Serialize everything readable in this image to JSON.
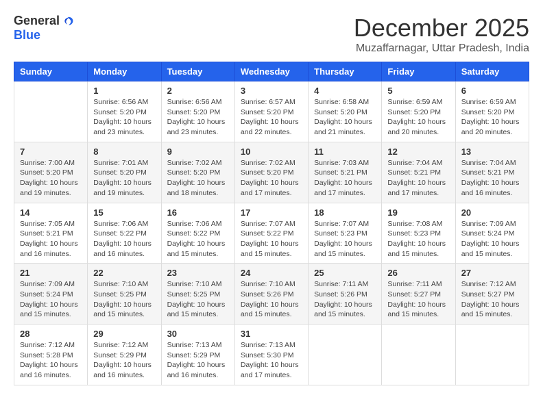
{
  "header": {
    "logo_general": "General",
    "logo_blue": "Blue",
    "month": "December 2025",
    "location": "Muzaffarnagar, Uttar Pradesh, India"
  },
  "days_of_week": [
    "Sunday",
    "Monday",
    "Tuesday",
    "Wednesday",
    "Thursday",
    "Friday",
    "Saturday"
  ],
  "weeks": [
    [
      {
        "day": "",
        "info": ""
      },
      {
        "day": "1",
        "info": "Sunrise: 6:56 AM\nSunset: 5:20 PM\nDaylight: 10 hours\nand 23 minutes."
      },
      {
        "day": "2",
        "info": "Sunrise: 6:56 AM\nSunset: 5:20 PM\nDaylight: 10 hours\nand 23 minutes."
      },
      {
        "day": "3",
        "info": "Sunrise: 6:57 AM\nSunset: 5:20 PM\nDaylight: 10 hours\nand 22 minutes."
      },
      {
        "day": "4",
        "info": "Sunrise: 6:58 AM\nSunset: 5:20 PM\nDaylight: 10 hours\nand 21 minutes."
      },
      {
        "day": "5",
        "info": "Sunrise: 6:59 AM\nSunset: 5:20 PM\nDaylight: 10 hours\nand 20 minutes."
      },
      {
        "day": "6",
        "info": "Sunrise: 6:59 AM\nSunset: 5:20 PM\nDaylight: 10 hours\nand 20 minutes."
      }
    ],
    [
      {
        "day": "7",
        "info": "Sunrise: 7:00 AM\nSunset: 5:20 PM\nDaylight: 10 hours\nand 19 minutes."
      },
      {
        "day": "8",
        "info": "Sunrise: 7:01 AM\nSunset: 5:20 PM\nDaylight: 10 hours\nand 19 minutes."
      },
      {
        "day": "9",
        "info": "Sunrise: 7:02 AM\nSunset: 5:20 PM\nDaylight: 10 hours\nand 18 minutes."
      },
      {
        "day": "10",
        "info": "Sunrise: 7:02 AM\nSunset: 5:20 PM\nDaylight: 10 hours\nand 17 minutes."
      },
      {
        "day": "11",
        "info": "Sunrise: 7:03 AM\nSunset: 5:21 PM\nDaylight: 10 hours\nand 17 minutes."
      },
      {
        "day": "12",
        "info": "Sunrise: 7:04 AM\nSunset: 5:21 PM\nDaylight: 10 hours\nand 17 minutes."
      },
      {
        "day": "13",
        "info": "Sunrise: 7:04 AM\nSunset: 5:21 PM\nDaylight: 10 hours\nand 16 minutes."
      }
    ],
    [
      {
        "day": "14",
        "info": "Sunrise: 7:05 AM\nSunset: 5:21 PM\nDaylight: 10 hours\nand 16 minutes."
      },
      {
        "day": "15",
        "info": "Sunrise: 7:06 AM\nSunset: 5:22 PM\nDaylight: 10 hours\nand 16 minutes."
      },
      {
        "day": "16",
        "info": "Sunrise: 7:06 AM\nSunset: 5:22 PM\nDaylight: 10 hours\nand 15 minutes."
      },
      {
        "day": "17",
        "info": "Sunrise: 7:07 AM\nSunset: 5:22 PM\nDaylight: 10 hours\nand 15 minutes."
      },
      {
        "day": "18",
        "info": "Sunrise: 7:07 AM\nSunset: 5:23 PM\nDaylight: 10 hours\nand 15 minutes."
      },
      {
        "day": "19",
        "info": "Sunrise: 7:08 AM\nSunset: 5:23 PM\nDaylight: 10 hours\nand 15 minutes."
      },
      {
        "day": "20",
        "info": "Sunrise: 7:09 AM\nSunset: 5:24 PM\nDaylight: 10 hours\nand 15 minutes."
      }
    ],
    [
      {
        "day": "21",
        "info": "Sunrise: 7:09 AM\nSunset: 5:24 PM\nDaylight: 10 hours\nand 15 minutes."
      },
      {
        "day": "22",
        "info": "Sunrise: 7:10 AM\nSunset: 5:25 PM\nDaylight: 10 hours\nand 15 minutes."
      },
      {
        "day": "23",
        "info": "Sunrise: 7:10 AM\nSunset: 5:25 PM\nDaylight: 10 hours\nand 15 minutes."
      },
      {
        "day": "24",
        "info": "Sunrise: 7:10 AM\nSunset: 5:26 PM\nDaylight: 10 hours\nand 15 minutes."
      },
      {
        "day": "25",
        "info": "Sunrise: 7:11 AM\nSunset: 5:26 PM\nDaylight: 10 hours\nand 15 minutes."
      },
      {
        "day": "26",
        "info": "Sunrise: 7:11 AM\nSunset: 5:27 PM\nDaylight: 10 hours\nand 15 minutes."
      },
      {
        "day": "27",
        "info": "Sunrise: 7:12 AM\nSunset: 5:27 PM\nDaylight: 10 hours\nand 15 minutes."
      }
    ],
    [
      {
        "day": "28",
        "info": "Sunrise: 7:12 AM\nSunset: 5:28 PM\nDaylight: 10 hours\nand 16 minutes."
      },
      {
        "day": "29",
        "info": "Sunrise: 7:12 AM\nSunset: 5:29 PM\nDaylight: 10 hours\nand 16 minutes."
      },
      {
        "day": "30",
        "info": "Sunrise: 7:13 AM\nSunset: 5:29 PM\nDaylight: 10 hours\nand 16 minutes."
      },
      {
        "day": "31",
        "info": "Sunrise: 7:13 AM\nSunset: 5:30 PM\nDaylight: 10 hours\nand 17 minutes."
      },
      {
        "day": "",
        "info": ""
      },
      {
        "day": "",
        "info": ""
      },
      {
        "day": "",
        "info": ""
      }
    ]
  ]
}
